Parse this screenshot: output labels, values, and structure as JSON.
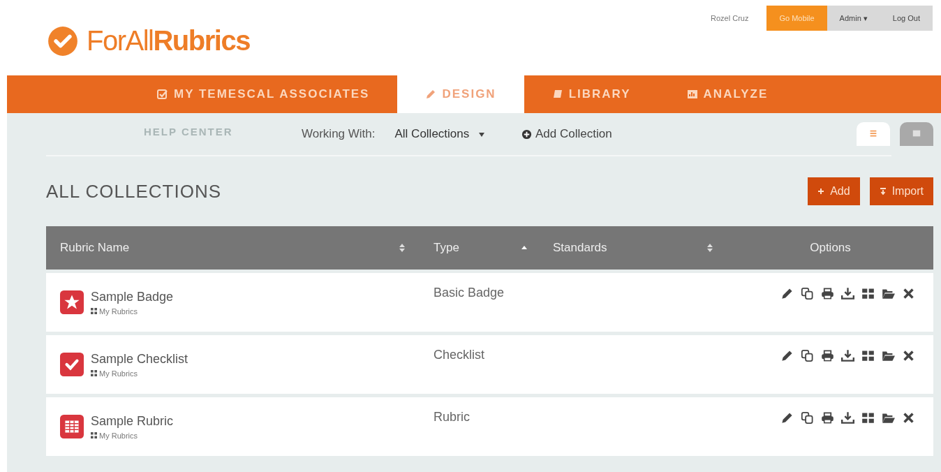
{
  "user_bar": {
    "user": "Rozel Cruz",
    "buttons": [
      {
        "label": "Go Mobile",
        "kind": "primary"
      },
      {
        "label": "Admin ▾",
        "kind": "plain"
      },
      {
        "label": "Log Out",
        "kind": "plain"
      }
    ]
  },
  "logo": {
    "text_part1": "ForAll",
    "text_part2": "Rubrics"
  },
  "nav": [
    {
      "label": "MY TEMESCAL ASSOCIATES",
      "selected": false
    },
    {
      "label": "DESIGN",
      "selected": true
    },
    {
      "label": "LIBRARY",
      "selected": false
    },
    {
      "label": "ANALYZE",
      "selected": false
    }
  ],
  "help_center": "HELP CENTER",
  "toolbar": {
    "working_with_label": "Working With:",
    "collection": "All Collections",
    "add_collection": "Add Collection",
    "views": [
      {
        "kind": "list",
        "selected": true
      },
      {
        "kind": "cards",
        "selected": false
      }
    ]
  },
  "heading": "ALL COLLECTIONS",
  "actions": [
    {
      "label": "Add",
      "kind": "add"
    },
    {
      "label": "Import",
      "kind": "import"
    }
  ],
  "table": {
    "columns": [
      {
        "label": "Rubric Name",
        "kind": "sortable"
      },
      {
        "label": "Type",
        "kind": "sorted"
      },
      {
        "label": "Standards",
        "kind": "sortable"
      },
      {
        "label": "Options",
        "kind": "plain"
      }
    ],
    "rows": [
      {
        "kind": "star",
        "name": "Sample Badge",
        "collection": "My Rubrics",
        "type": "Basic Badge"
      },
      {
        "kind": "check",
        "name": "Sample Checklist",
        "collection": "My Rubrics",
        "type": "Checklist"
      },
      {
        "kind": "grid",
        "name": "Sample Rubric",
        "collection": "My Rubrics",
        "type": "Rubric"
      }
    ]
  }
}
